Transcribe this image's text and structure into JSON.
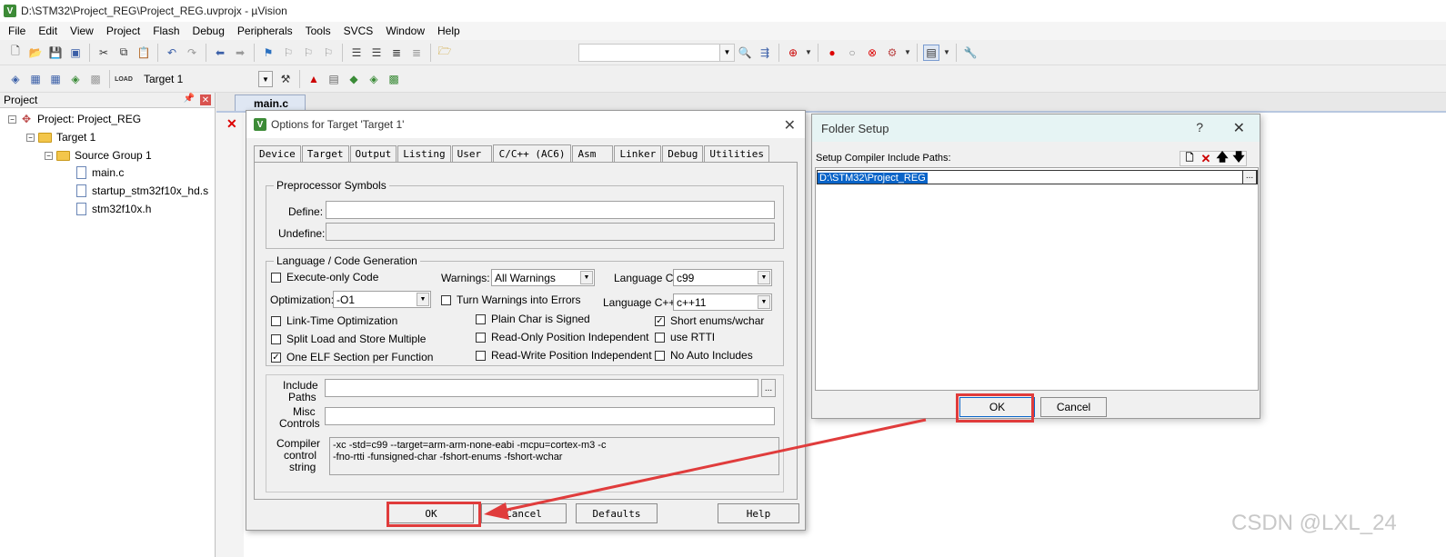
{
  "window": {
    "title": "D:\\STM32\\Project_REG\\Project_REG.uvprojx - µVision"
  },
  "menu": [
    "File",
    "Edit",
    "View",
    "Project",
    "Flash",
    "Debug",
    "Peripherals",
    "Tools",
    "SVCS",
    "Window",
    "Help"
  ],
  "toolbar2": {
    "target": "Target 1",
    "load_label": "LOAD"
  },
  "project": {
    "title": "Project",
    "root": "Project: Project_REG",
    "target": "Target 1",
    "group": "Source Group 1",
    "files": [
      "main.c",
      "startup_stm32f10x_hd.s",
      "stm32f10x.h"
    ]
  },
  "editor": {
    "tab": "main.c"
  },
  "options": {
    "title": "Options for Target 'Target 1'",
    "tabs": [
      "Device",
      "Target",
      "Output",
      "Listing",
      "User",
      "C/C++ (AC6)",
      "Asm",
      "Linker",
      "Debug",
      "Utilities"
    ],
    "preprocessor": {
      "title": "Preprocessor Symbols",
      "define_label": "Define:",
      "undefine_label": "Undefine:",
      "define_value": "",
      "undefine_value": ""
    },
    "language": {
      "title": "Language / Code Generation",
      "execute_only": "Execute-only Code",
      "warnings_label": "Warnings:",
      "warnings_value": "All Warnings",
      "language_c_label": "Language C:",
      "language_c_value": "c99",
      "optimization_label": "Optimization:",
      "optimization_value": "-O1",
      "turn_warnings": "Turn Warnings into Errors",
      "language_cpp_label": "Language C++:",
      "language_cpp_value": "c++11",
      "link_time": "Link-Time Optimization",
      "plain_char": "Plain Char is Signed",
      "short_enums": "Short enums/wchar",
      "split_load": "Split Load and Store Multiple",
      "ro_pi": "Read-Only Position Independent",
      "use_rtti": "use RTTI",
      "one_elf": "One ELF Section per Function",
      "rw_pi": "Read-Write Position Independent",
      "no_auto": "No Auto Includes",
      "check": "✓"
    },
    "include_label_1": "Include",
    "include_label_2": "Paths",
    "include_value": "",
    "misc_label_1": "Misc",
    "misc_label_2": "Controls",
    "misc_value": "",
    "compiler_label_1": "Compiler",
    "compiler_label_2": "control",
    "compiler_label_3": "string",
    "compiler_string": "-xc -std=c99 --target=arm-arm-none-eabi -mcpu=cortex-m3 -c\n-fno-rtti -funsigned-char -fshort-enums -fshort-wchar",
    "buttons": {
      "ok": "OK",
      "cancel": "Cancel",
      "defaults": "Defaults",
      "help": "Help"
    },
    "dots": "..."
  },
  "folder_setup": {
    "title": "Folder Setup",
    "help": "?",
    "label": "Setup Compiler Include Paths:",
    "path": "D:\\STM32\\Project_REG",
    "dots": "...",
    "ok": "OK",
    "cancel": "Cancel"
  },
  "watermark": "CSDN @LXL_24",
  "colors": {
    "highlight": "#e03c3c",
    "selection": "#0a64c8"
  }
}
